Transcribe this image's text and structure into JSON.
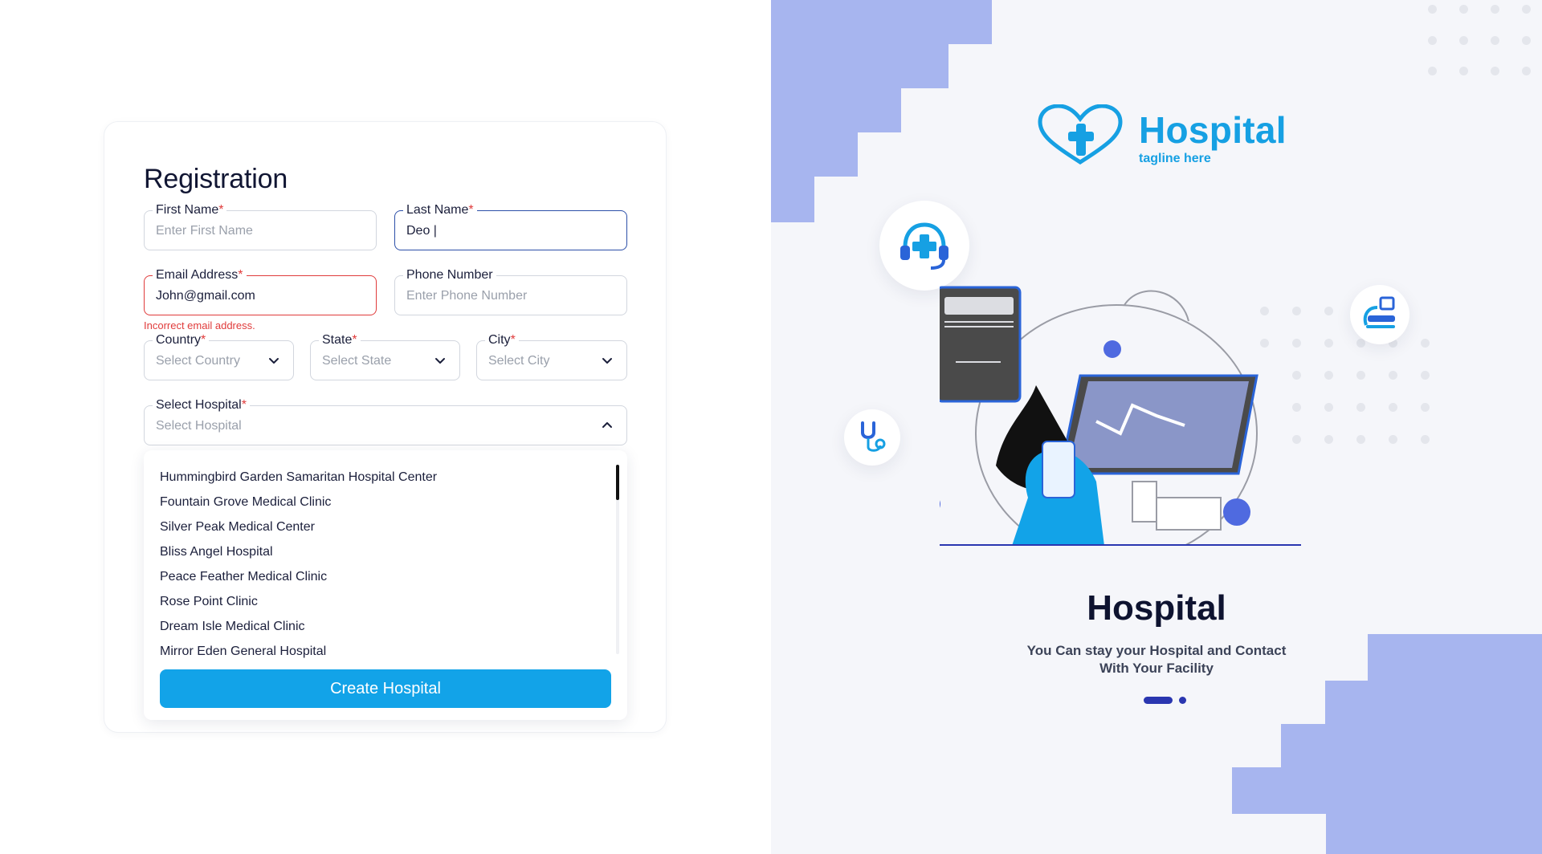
{
  "form": {
    "title": "Registration",
    "first_name": {
      "label": "First Name",
      "required": "*",
      "placeholder": "Enter First Name"
    },
    "last_name": {
      "label": "Last Name",
      "required": "*",
      "value": "Deo |"
    },
    "email": {
      "label": "Email Address",
      "required": "*",
      "value": "John@gmail.com",
      "error": "Incorrect email address."
    },
    "phone": {
      "label": "Phone Number",
      "placeholder": "Enter Phone Number"
    },
    "country": {
      "label": "Country",
      "required": "*",
      "placeholder": "Select Country"
    },
    "state": {
      "label": "State",
      "required": "*",
      "placeholder": "Select State"
    },
    "city": {
      "label": "City",
      "required": "*",
      "placeholder": "Select City"
    },
    "hospital": {
      "label": "Select Hospital",
      "required": "*",
      "placeholder": "Select Hospital"
    },
    "hospital_options": [
      "Hummingbird Garden Samaritan Hospital Center",
      "Fountain Grove Medical Clinic",
      "Silver Peak Medical Center",
      "Bliss Angel Hospital",
      "Peace Feather Medical Clinic",
      "Rose Point Clinic",
      "Dream Isle Medical Clinic",
      "Mirror Eden General Hospital"
    ],
    "create_button": "Create Hospital"
  },
  "brand": {
    "name": "Hospital",
    "tagline": "tagline here",
    "color": "#16a0e3"
  },
  "hero": {
    "title": "Hospital",
    "subtitle": "You Can stay your Hospital and Contact With Your Facility"
  },
  "colors": {
    "accent": "#12a3e8",
    "error": "#e03b3b",
    "focus": "#2c4fa8",
    "decor": "#a7b5ef",
    "pager": "#2a36b0"
  },
  "pager": {
    "pages": 2,
    "active": 1
  }
}
